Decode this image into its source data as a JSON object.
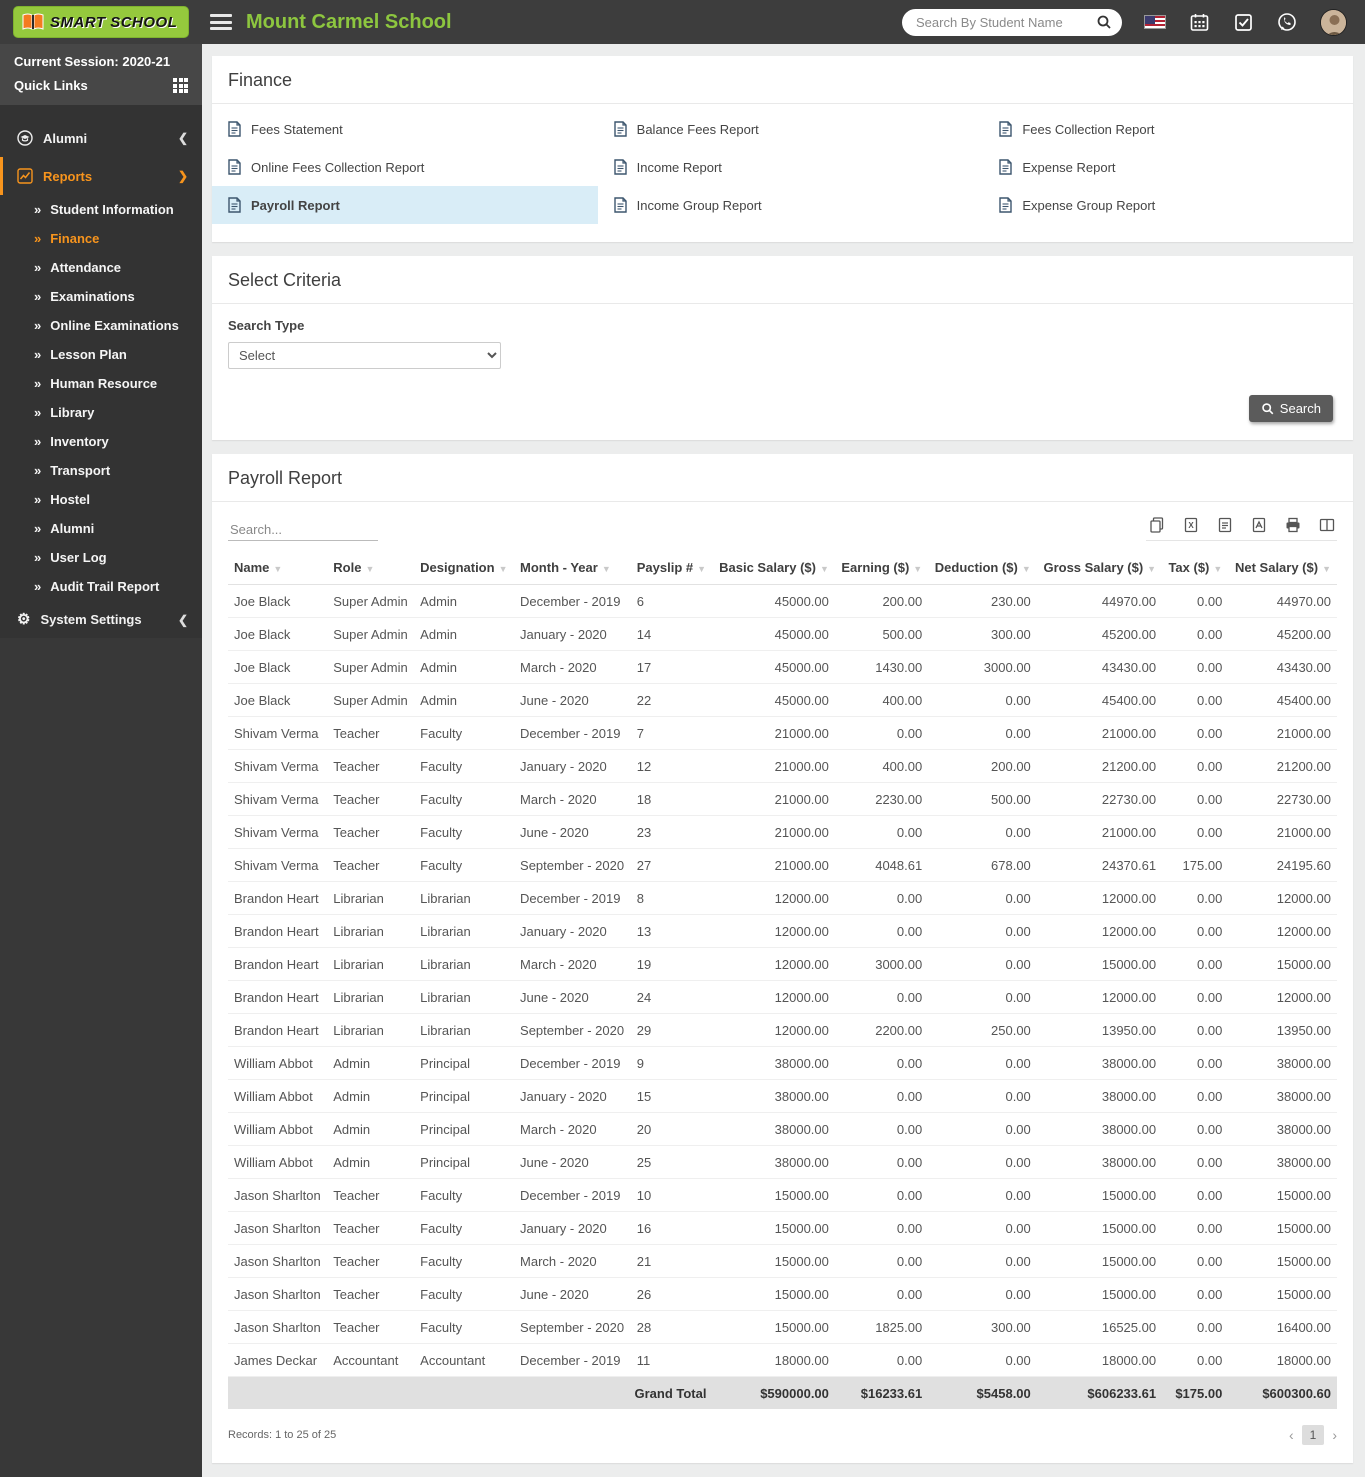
{
  "header": {
    "logo_text": "SMART SCHOOL",
    "school_name": "Mount Carmel School",
    "search_placeholder": "Search By Student Name"
  },
  "sidebar": {
    "session_label": "Current Session: 2020-21",
    "quick_links_label": "Quick Links",
    "alumni_label": "Alumni",
    "reports_label": "Reports",
    "system_settings_label": "System Settings",
    "report_items": [
      {
        "label": "Student Information",
        "active": false
      },
      {
        "label": "Finance",
        "active": true
      },
      {
        "label": "Attendance",
        "active": false
      },
      {
        "label": "Examinations",
        "active": false
      },
      {
        "label": "Online Examinations",
        "active": false
      },
      {
        "label": "Lesson Plan",
        "active": false
      },
      {
        "label": "Human Resource",
        "active": false
      },
      {
        "label": "Library",
        "active": false
      },
      {
        "label": "Inventory",
        "active": false
      },
      {
        "label": "Transport",
        "active": false
      },
      {
        "label": "Hostel",
        "active": false
      },
      {
        "label": "Alumni",
        "active": false
      },
      {
        "label": "User Log",
        "active": false
      },
      {
        "label": "Audit Trail Report",
        "active": false
      }
    ]
  },
  "finance_card": {
    "title": "Finance",
    "links": [
      {
        "label": "Fees Statement",
        "active": false
      },
      {
        "label": "Balance Fees Report",
        "active": false
      },
      {
        "label": "Fees Collection Report",
        "active": false
      },
      {
        "label": "Online Fees Collection Report",
        "active": false
      },
      {
        "label": "Income Report",
        "active": false
      },
      {
        "label": "Expense Report",
        "active": false
      },
      {
        "label": "Payroll Report",
        "active": true
      },
      {
        "label": "Income Group Report",
        "active": false
      },
      {
        "label": "Expense Group Report",
        "active": false
      }
    ]
  },
  "criteria_card": {
    "title": "Select Criteria",
    "search_type_label": "Search Type",
    "select_value": "Select",
    "search_button_label": "Search"
  },
  "payroll_card": {
    "title": "Payroll Report",
    "table_search_placeholder": "Search...",
    "export_actions": [
      "copy",
      "excel",
      "text",
      "pdf",
      "print",
      "columns"
    ],
    "columns": [
      "Name",
      "Role",
      "Designation",
      "Month - Year",
      "Payslip #",
      "Basic Salary ($)",
      "Earning ($)",
      "Deduction ($)",
      "Gross Salary ($)",
      "Tax ($)",
      "Net Salary ($)"
    ],
    "numeric_columns_from_index": 5,
    "rows": [
      [
        "Joe Black",
        "Super Admin",
        "Admin",
        "December - 2019",
        "6",
        "45000.00",
        "200.00",
        "230.00",
        "44970.00",
        "0.00",
        "44970.00"
      ],
      [
        "Joe Black",
        "Super Admin",
        "Admin",
        "January - 2020",
        "14",
        "45000.00",
        "500.00",
        "300.00",
        "45200.00",
        "0.00",
        "45200.00"
      ],
      [
        "Joe Black",
        "Super Admin",
        "Admin",
        "March - 2020",
        "17",
        "45000.00",
        "1430.00",
        "3000.00",
        "43430.00",
        "0.00",
        "43430.00"
      ],
      [
        "Joe Black",
        "Super Admin",
        "Admin",
        "June - 2020",
        "22",
        "45000.00",
        "400.00",
        "0.00",
        "45400.00",
        "0.00",
        "45400.00"
      ],
      [
        "Shivam Verma",
        "Teacher",
        "Faculty",
        "December - 2019",
        "7",
        "21000.00",
        "0.00",
        "0.00",
        "21000.00",
        "0.00",
        "21000.00"
      ],
      [
        "Shivam Verma",
        "Teacher",
        "Faculty",
        "January - 2020",
        "12",
        "21000.00",
        "400.00",
        "200.00",
        "21200.00",
        "0.00",
        "21200.00"
      ],
      [
        "Shivam Verma",
        "Teacher",
        "Faculty",
        "March - 2020",
        "18",
        "21000.00",
        "2230.00",
        "500.00",
        "22730.00",
        "0.00",
        "22730.00"
      ],
      [
        "Shivam Verma",
        "Teacher",
        "Faculty",
        "June - 2020",
        "23",
        "21000.00",
        "0.00",
        "0.00",
        "21000.00",
        "0.00",
        "21000.00"
      ],
      [
        "Shivam Verma",
        "Teacher",
        "Faculty",
        "September - 2020",
        "27",
        "21000.00",
        "4048.61",
        "678.00",
        "24370.61",
        "175.00",
        "24195.60"
      ],
      [
        "Brandon Heart",
        "Librarian",
        "Librarian",
        "December - 2019",
        "8",
        "12000.00",
        "0.00",
        "0.00",
        "12000.00",
        "0.00",
        "12000.00"
      ],
      [
        "Brandon Heart",
        "Librarian",
        "Librarian",
        "January - 2020",
        "13",
        "12000.00",
        "0.00",
        "0.00",
        "12000.00",
        "0.00",
        "12000.00"
      ],
      [
        "Brandon Heart",
        "Librarian",
        "Librarian",
        "March - 2020",
        "19",
        "12000.00",
        "3000.00",
        "0.00",
        "15000.00",
        "0.00",
        "15000.00"
      ],
      [
        "Brandon Heart",
        "Librarian",
        "Librarian",
        "June - 2020",
        "24",
        "12000.00",
        "0.00",
        "0.00",
        "12000.00",
        "0.00",
        "12000.00"
      ],
      [
        "Brandon Heart",
        "Librarian",
        "Librarian",
        "September - 2020",
        "29",
        "12000.00",
        "2200.00",
        "250.00",
        "13950.00",
        "0.00",
        "13950.00"
      ],
      [
        "William Abbot",
        "Admin",
        "Principal",
        "December - 2019",
        "9",
        "38000.00",
        "0.00",
        "0.00",
        "38000.00",
        "0.00",
        "38000.00"
      ],
      [
        "William Abbot",
        "Admin",
        "Principal",
        "January - 2020",
        "15",
        "38000.00",
        "0.00",
        "0.00",
        "38000.00",
        "0.00",
        "38000.00"
      ],
      [
        "William Abbot",
        "Admin",
        "Principal",
        "March - 2020",
        "20",
        "38000.00",
        "0.00",
        "0.00",
        "38000.00",
        "0.00",
        "38000.00"
      ],
      [
        "William Abbot",
        "Admin",
        "Principal",
        "June - 2020",
        "25",
        "38000.00",
        "0.00",
        "0.00",
        "38000.00",
        "0.00",
        "38000.00"
      ],
      [
        "Jason Sharlton",
        "Teacher",
        "Faculty",
        "December - 2019",
        "10",
        "15000.00",
        "0.00",
        "0.00",
        "15000.00",
        "0.00",
        "15000.00"
      ],
      [
        "Jason Sharlton",
        "Teacher",
        "Faculty",
        "January - 2020",
        "16",
        "15000.00",
        "0.00",
        "0.00",
        "15000.00",
        "0.00",
        "15000.00"
      ],
      [
        "Jason Sharlton",
        "Teacher",
        "Faculty",
        "March - 2020",
        "21",
        "15000.00",
        "0.00",
        "0.00",
        "15000.00",
        "0.00",
        "15000.00"
      ],
      [
        "Jason Sharlton",
        "Teacher",
        "Faculty",
        "June - 2020",
        "26",
        "15000.00",
        "0.00",
        "0.00",
        "15000.00",
        "0.00",
        "15000.00"
      ],
      [
        "Jason Sharlton",
        "Teacher",
        "Faculty",
        "September - 2020",
        "28",
        "15000.00",
        "1825.00",
        "300.00",
        "16525.00",
        "0.00",
        "16400.00"
      ],
      [
        "James Deckar",
        "Accountant",
        "Accountant",
        "December - 2019",
        "11",
        "18000.00",
        "0.00",
        "0.00",
        "18000.00",
        "0.00",
        "18000.00"
      ]
    ],
    "grand_total": {
      "label": "Grand Total",
      "values": [
        "$590000.00",
        "$16233.61",
        "$5458.00",
        "$606233.61",
        "$175.00",
        "$600300.60"
      ]
    },
    "records_text": "Records: 1 to 25 of 25",
    "pagination": {
      "prev": "‹",
      "page": "1",
      "next": "›"
    }
  },
  "colors": {
    "accent_orange": "#f7941d",
    "brand_green": "#8dc63f",
    "link_blue": "#418bca",
    "active_link_bg": "#d9edf7",
    "header_bg": "#3d3d3d",
    "sidebar_bg": "#333333",
    "grand_total_bg": "#e0e0e0"
  }
}
